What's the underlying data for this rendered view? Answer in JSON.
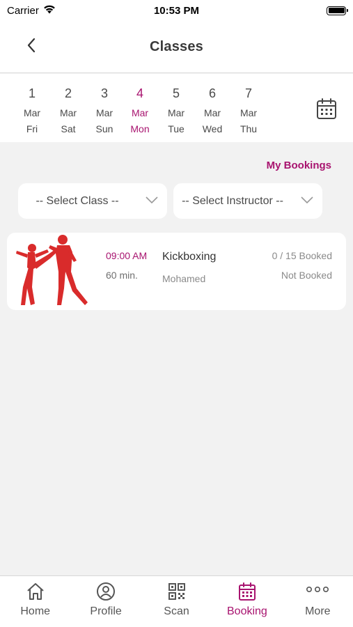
{
  "status_bar": {
    "carrier": "Carrier",
    "time": "10:53 PM"
  },
  "header": {
    "title": "Classes",
    "back_icon": "chevron-left-icon"
  },
  "date_strip": {
    "dates": [
      {
        "day": "1",
        "month": "Mar",
        "weekday": "Fri",
        "selected": false
      },
      {
        "day": "2",
        "month": "Mar",
        "weekday": "Sat",
        "selected": false
      },
      {
        "day": "3",
        "month": "Mar",
        "weekday": "Sun",
        "selected": false
      },
      {
        "day": "4",
        "month": "Mar",
        "weekday": "Mon",
        "selected": true
      },
      {
        "day": "5",
        "month": "Mar",
        "weekday": "Tue",
        "selected": false
      },
      {
        "day": "6",
        "month": "Mar",
        "weekday": "Wed",
        "selected": false
      },
      {
        "day": "7",
        "month": "Mar",
        "weekday": "Thu",
        "selected": false
      }
    ],
    "calendar_icon": "calendar-icon"
  },
  "my_bookings_label": "My Bookings",
  "filters": {
    "class_select": "-- Select Class --",
    "instructor_select": "-- Select Instructor --"
  },
  "classes": [
    {
      "time": "09:00 AM",
      "duration": "60 min.",
      "name": "Kickboxing",
      "instructor": "Mohamed",
      "booked": "0 / 15 Booked",
      "status": "Not Booked"
    }
  ],
  "tab_bar": {
    "items": [
      {
        "label": "Home",
        "icon": "home-icon",
        "active": false
      },
      {
        "label": "Profile",
        "icon": "profile-icon",
        "active": false
      },
      {
        "label": "Scan",
        "icon": "qr-code-icon",
        "active": false
      },
      {
        "label": "Booking",
        "icon": "calendar-icon",
        "active": true
      },
      {
        "label": "More",
        "icon": "more-icon",
        "active": false
      }
    ]
  },
  "colors": {
    "accent": "#a8136f",
    "background": "#f2f2f2",
    "card": "#ffffff",
    "kickboxer": "#d92b2b"
  }
}
